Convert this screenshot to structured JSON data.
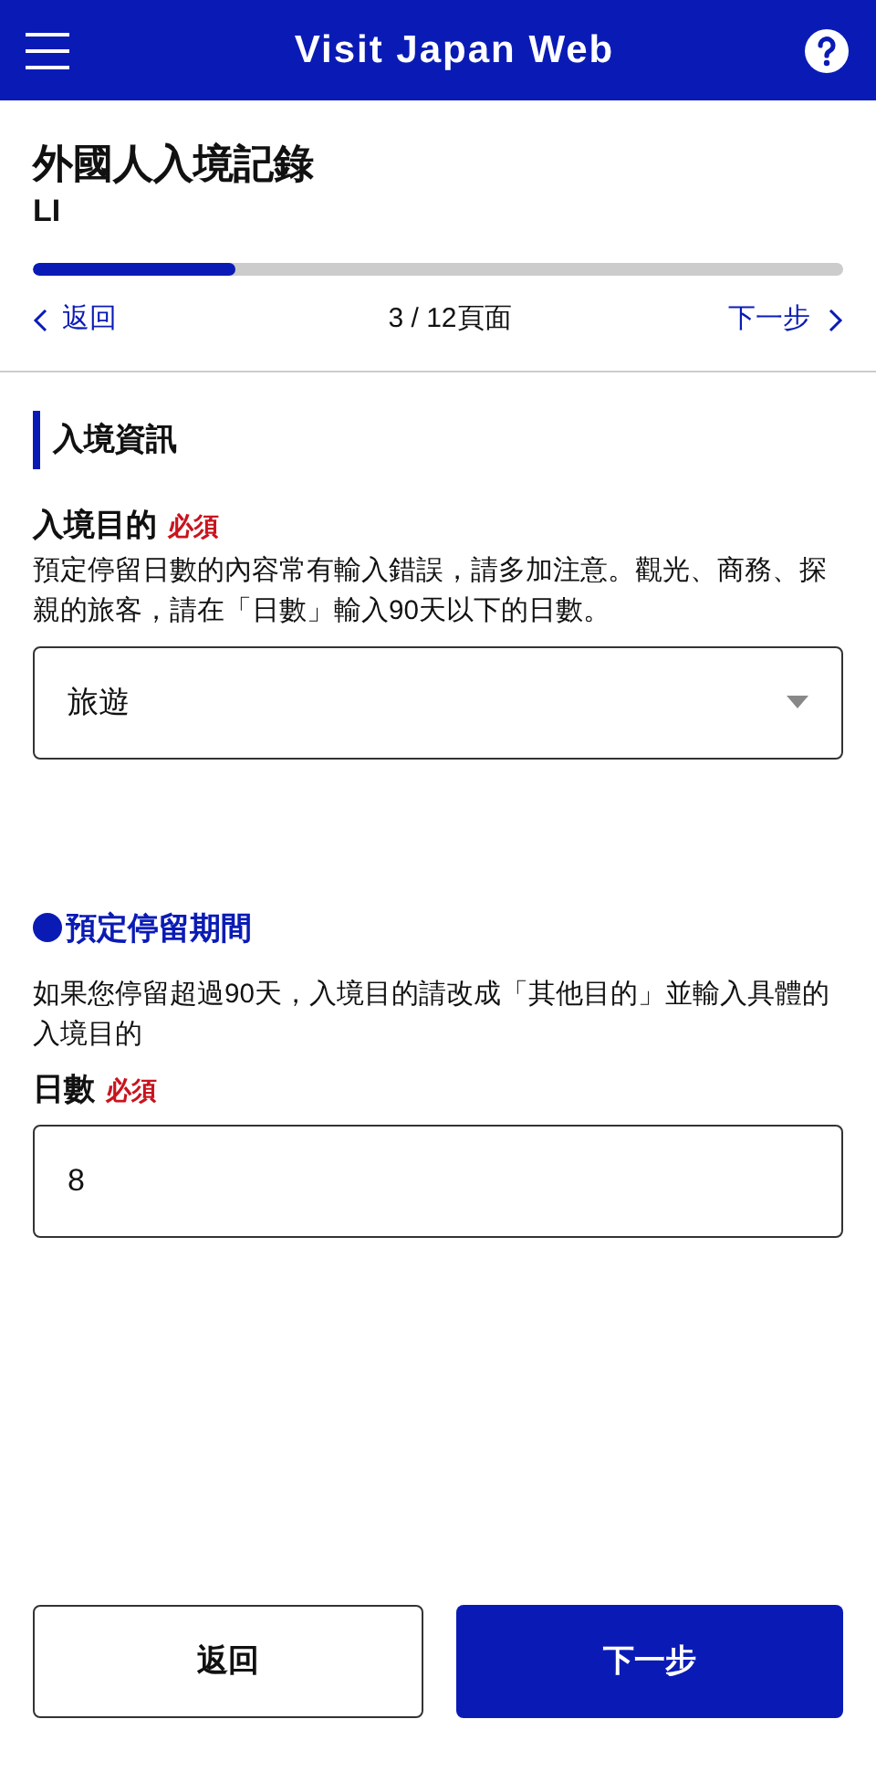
{
  "header": {
    "title": "Visit Japan Web"
  },
  "page": {
    "title": "外國人入境記錄",
    "name": "LI"
  },
  "progress": {
    "level": 0.25,
    "label": "3 / 12頁面"
  },
  "nav": {
    "back": "返回",
    "next": "下一步"
  },
  "section": {
    "title": "入境資訊"
  },
  "purpose": {
    "label": "入境目的",
    "required": "必須",
    "note": "預定停留日數的內容常有輸入錯誤，請多加注意。觀光、商務、探親的旅客，請在「日數」輸入90天以下的日數。",
    "value": "旅遊"
  },
  "stay": {
    "title": "預定停留期間",
    "note": "如果您停留超過90天，入境目的請改成「其他目的」並輸入具體的入境目的",
    "label": "日數",
    "required": "必須",
    "value": "8"
  },
  "buttons": {
    "back": "返回",
    "next": "下一步"
  }
}
